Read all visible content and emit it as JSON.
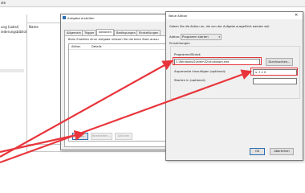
{
  "background": {
    "toolbar_text": "ste",
    "left_items": [
      "ung (Lokal)",
      "iederungsbibliot"
    ],
    "middle_header": "Name"
  },
  "task_dialog": {
    "title": "Aufgabe erstellen",
    "tabs": [
      "Allgemein",
      "Trigger",
      "Aktionen",
      "Bedingungen",
      "Einstellungen"
    ],
    "active_tab": "Aktionen",
    "description": "Beim Erstellen einer Aufgabe müssen Sie die beim Start auszu",
    "columns": [
      "Aktion",
      "Details"
    ],
    "buttons": {
      "new": "Neu...",
      "edit": "Bearbeiten...",
      "delete": "Löschen"
    }
  },
  "new_action_dialog": {
    "title": "Neue Aktion",
    "close_glyph": "✕",
    "instruction": "Geben Sie die Aktion an, die von der Aufgabe ausgeführt werden soll.",
    "action_label": "Aktion:",
    "action_value": "Programm starten",
    "settings_group": "Einstellungen",
    "program_label": "Programm/Skript:",
    "program_value": "C:\\Windows\\System32\\shutdown.exe",
    "browse_button": "Durchsuchen...",
    "args_label": "Argumente hinzufügen (optional):",
    "args_value": "-s -f -t 0",
    "start_label": "Starten in (optional):",
    "start_value": "",
    "ok_button": "OK",
    "cancel_button": "Abbrechen"
  },
  "colors": {
    "highlight": "#e8353b",
    "arrow": "#e8353b",
    "window_bg": "#f0f0f0"
  }
}
